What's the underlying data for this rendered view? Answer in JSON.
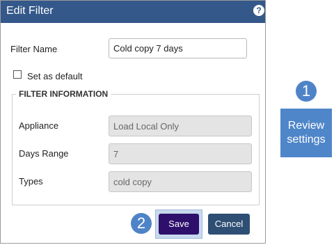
{
  "dialog": {
    "title": "Edit Filter",
    "help_icon": "?",
    "filter_name_label": "Filter Name",
    "filter_name_value": "Cold copy 7 days",
    "set_default_label": "Set as default",
    "set_default_checked": false,
    "section_title": "FILTER INFORMATION",
    "fields": [
      {
        "label": "Appliance",
        "value": "Load Local Only"
      },
      {
        "label": "Days Range",
        "value": "7"
      },
      {
        "label": "Types",
        "value": "cold copy"
      }
    ],
    "save_label": "Save",
    "cancel_label": "Cancel"
  },
  "annotations": {
    "step1_number": "1",
    "step1_text": "Review settings",
    "step2_number": "2"
  },
  "colors": {
    "titlebar": "#34588a",
    "save_button": "#2e0f6b",
    "cancel_button": "#2e4e73",
    "callout": "#4f86c9"
  }
}
